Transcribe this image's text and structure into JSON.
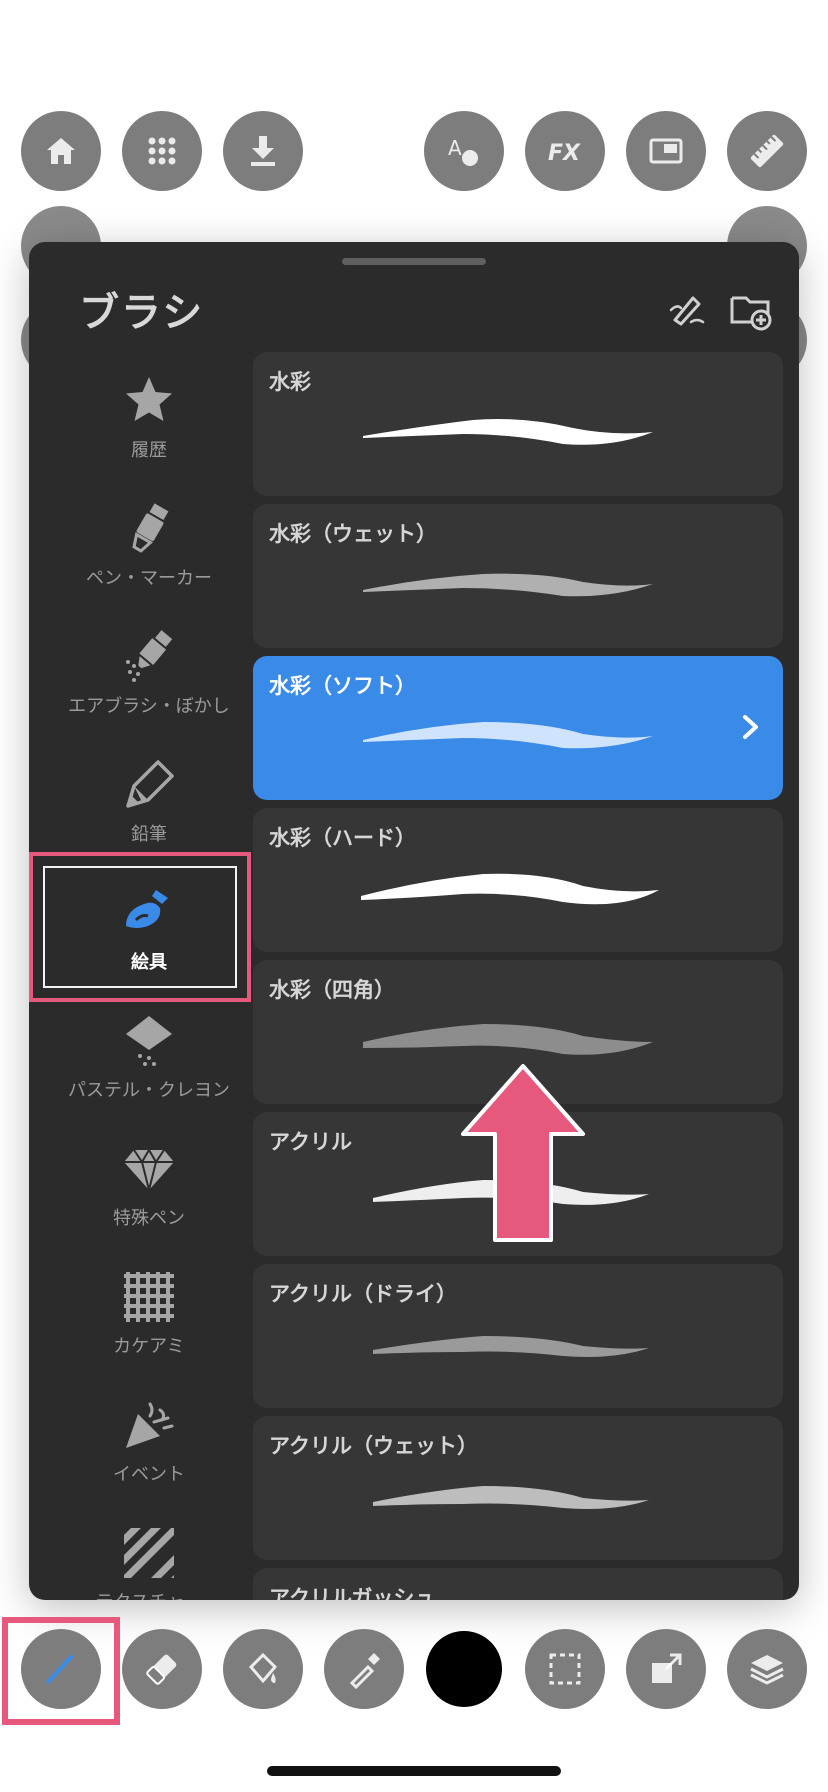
{
  "panel": {
    "title": "ブラシ",
    "header_icons": [
      "brush-edit-icon",
      "add-folder-icon"
    ]
  },
  "categories": [
    {
      "label": "履歴",
      "icon": "star-icon"
    },
    {
      "label": "ペン・マーカー",
      "icon": "marker-icon"
    },
    {
      "label": "エアブラシ・ぼかし",
      "icon": "airbrush-icon"
    },
    {
      "label": "鉛筆",
      "icon": "pencil-icon"
    },
    {
      "label": "絵具",
      "icon": "paint-brush-icon",
      "selected": true
    },
    {
      "label": "パステル・クレヨン",
      "icon": "pastel-icon"
    },
    {
      "label": "特殊ペン",
      "icon": "diamond-icon"
    },
    {
      "label": "カケアミ",
      "icon": "grid-icon"
    },
    {
      "label": "イベント",
      "icon": "party-popper-icon"
    },
    {
      "label": "テクスチャー",
      "icon": "stripes-icon"
    }
  ],
  "brushes": [
    {
      "name": "水彩"
    },
    {
      "name": "水彩（ウェット）"
    },
    {
      "name": "水彩（ソフト）",
      "selected": true
    },
    {
      "name": "水彩（ハード）"
    },
    {
      "name": "水彩（四角）"
    },
    {
      "name": "アクリル"
    },
    {
      "name": "アクリル（ドライ）"
    },
    {
      "name": "アクリル（ウェット）"
    },
    {
      "name": "アクリルガッシュ"
    }
  ],
  "top_toolbar": [
    "home-icon",
    "apps-grid-icon",
    "download-icon",
    "text-shape-icon",
    "fx-icon",
    "canvas-frame-icon",
    "ruler-icon"
  ],
  "bottom_toolbar": [
    "brush-tool-icon",
    "eraser-icon",
    "fill-bucket-icon",
    "eyedropper-icon",
    "color-well",
    "selection-icon",
    "transform-icon",
    "layers-icon"
  ],
  "colors": {
    "panel_bg": "#2b2b2b",
    "accent_blue": "#3a8ae8",
    "highlight_pink": "#e6587c",
    "current_color": "#000000"
  }
}
